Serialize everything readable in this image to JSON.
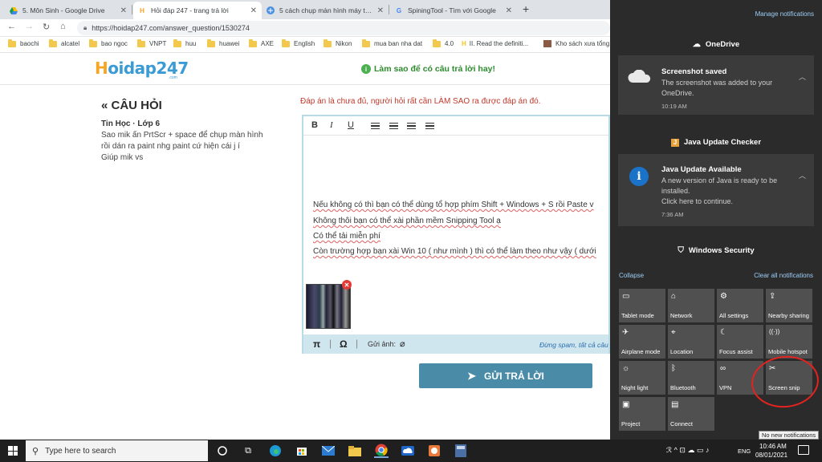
{
  "browser": {
    "tabs": [
      {
        "title": "5. Môn Sinh - Google Drive",
        "icon": "google-drive-icon",
        "active": false
      },
      {
        "title": "Hỏi đáp 247 - trang trả lời",
        "icon": "hoidap-h-icon",
        "active": true
      },
      {
        "title": "5 cách chụp màn hình máy tính,",
        "icon": "site-icon",
        "active": false
      },
      {
        "title": "SpiningTool - Tìm với Google",
        "icon": "google-icon",
        "active": false
      }
    ],
    "url": "https://hoidap247.com/answer_question/1530274",
    "bookmarks": [
      "baochi",
      "alcatel",
      "bao ngoc",
      "VNPT",
      "huu",
      "huawei",
      "AXE",
      "English",
      "Nikon",
      "mua ban nha dat",
      "4.0",
      "II. Read the definiti...",
      "Kho sách xưa tổng..."
    ]
  },
  "site": {
    "logo_h": "H",
    "logo_rest": "oidap247",
    "logo_domain": ".com",
    "hint": "Làm sao để có câu trả lời hay!"
  },
  "question": {
    "heading": "« CÂU HỎI",
    "subject": "Tin Học · Lớp 6",
    "lines": [
      "Sao mik ấn PrtScr + space để chụp màn hình",
      "rồi dán ra paint nhg paint cứ hiện cái j í",
      "Giúp mik vs"
    ]
  },
  "answer": {
    "notice": "Đáp án là chưa đủ, người hỏi rất cần LÀM SAO ra được đáp án đó.",
    "toolbar": {
      "bold": "B",
      "italic": "I",
      "underline": "U"
    },
    "lines": [
      "Nếu không có thì bạn có thể dùng tổ hợp phím Shift + Windows + S rồi Paste v",
      "Không thôi bạn có thể xài phần mềm Snipping Tool ạ",
      "Có thể tải miễn phí",
      "Còn trường hợp bạn xài Win 10 ( như mình ) thì có thể làm theo như vậy ( dưới"
    ],
    "pi": "π",
    "omega": "Ω",
    "attach_label": "Gửi ảnh:",
    "spam_note": "Đừng spam, tất cả câu",
    "submit_label": "GỬI TRẢ LỜI"
  },
  "action_center": {
    "manage": "Manage notifications",
    "groups": {
      "onedrive": "OneDrive",
      "java": "Java Update Checker",
      "security": "Windows Security"
    },
    "notifications": {
      "onedrive": {
        "title": "Screenshot saved",
        "body": "The screenshot was added to your OneDrive.",
        "time": "10:19 AM"
      },
      "java": {
        "title": "Java Update Available",
        "body": "A new version of Java is ready to be installed.",
        "body2": "Click here to continue.",
        "time": "7:36 AM"
      }
    },
    "collapse": "Collapse",
    "clear_all": "Clear all notifications",
    "quick_actions": [
      {
        "label": "Tablet mode",
        "icon": "tablet-icon",
        "glyph": "▭"
      },
      {
        "label": "Network",
        "icon": "network-icon",
        "glyph": "⌂"
      },
      {
        "label": "All settings",
        "icon": "gear-icon",
        "glyph": "⚙"
      },
      {
        "label": "Nearby sharing",
        "icon": "share-icon",
        "glyph": "⇪"
      },
      {
        "label": "Airplane mode",
        "icon": "airplane-icon",
        "glyph": "✈"
      },
      {
        "label": "Location",
        "icon": "location-icon",
        "glyph": "⌖"
      },
      {
        "label": "Focus assist",
        "icon": "moon-icon",
        "glyph": "☾"
      },
      {
        "label": "Mobile hotspot",
        "icon": "hotspot-icon",
        "glyph": "((·))"
      },
      {
        "label": "Night light",
        "icon": "sun-icon",
        "glyph": "☼"
      },
      {
        "label": "Bluetooth",
        "icon": "bluetooth-icon",
        "glyph": "ᛒ"
      },
      {
        "label": "VPN",
        "icon": "vpn-icon",
        "glyph": "∞"
      },
      {
        "label": "Screen snip",
        "icon": "scissors-icon",
        "glyph": "✂"
      },
      {
        "label": "Project",
        "icon": "project-icon",
        "glyph": "▣"
      },
      {
        "label": "Connect",
        "icon": "connect-icon",
        "glyph": "▤"
      }
    ],
    "tooltip": "No new notifications"
  },
  "taskbar": {
    "search_placeholder": "Type here to search",
    "tray_icons": "ℛ ^ ⊡ ☁ ▭ ♪",
    "lang": "ENG",
    "time": "10:46 AM",
    "date": "08/01/2021"
  },
  "colors": {
    "accent": "#4a8ba8",
    "action_center_bg": "#2b2b2b",
    "highlight": "#e3231f"
  }
}
